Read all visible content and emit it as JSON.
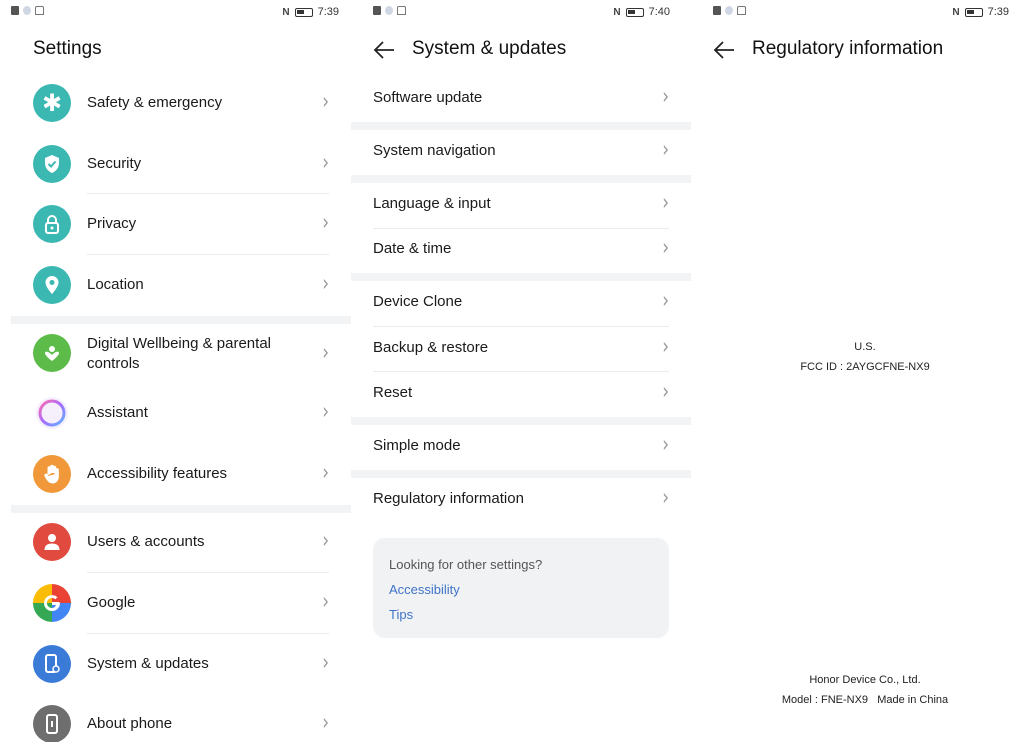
{
  "panel1": {
    "status_time": "7:39",
    "title": "Settings",
    "items": [
      {
        "label": "Safety & emergency",
        "icon": "asterisk-icon",
        "color": "#3cb8b2"
      },
      {
        "label": "Security",
        "icon": "shield-check-icon",
        "color": "#3cb8b2"
      },
      {
        "label": "Privacy",
        "icon": "lock-icon",
        "color": "#3cb8b2"
      },
      {
        "label": "Location",
        "icon": "location-pin-icon",
        "color": "#3cb8b2"
      },
      {
        "label": "Digital Wellbeing & parental controls",
        "icon": "heart-icon",
        "color": "#5dbb4a"
      },
      {
        "label": "Assistant",
        "icon": "assistant-ring-icon",
        "color": "#b56ae8"
      },
      {
        "label": "Accessibility features",
        "icon": "hand-icon",
        "color": "#f0983a"
      },
      {
        "label": "Users & accounts",
        "icon": "person-icon",
        "color": "#e14a3f"
      },
      {
        "label": "Google",
        "icon": "google-icon",
        "color": "#4285f4"
      },
      {
        "label": "System & updates",
        "icon": "phone-settings-icon",
        "color": "#3a7bd8"
      },
      {
        "label": "About phone",
        "icon": "phone-info-icon",
        "color": "#6e6e6e"
      }
    ]
  },
  "panel2": {
    "status_time": "7:40",
    "title": "System & updates",
    "items": [
      {
        "label": "Software update"
      },
      {
        "label": "System navigation"
      },
      {
        "label": "Language & input"
      },
      {
        "label": "Date & time"
      },
      {
        "label": "Device Clone"
      },
      {
        "label": "Backup & restore"
      },
      {
        "label": "Reset"
      },
      {
        "label": "Simple mode"
      },
      {
        "label": "Regulatory information"
      }
    ],
    "card": {
      "question": "Looking for other settings?",
      "link1": "Accessibility",
      "link2": "Tips"
    }
  },
  "panel3": {
    "status_time": "7:39",
    "title": "Regulatory information",
    "region": "U.S.",
    "fcc_id": "FCC ID : 2AYGCFNE-NX9",
    "manufacturer": "Honor Device Co., Ltd.",
    "model": "Model : FNE-NX9   Made in China"
  },
  "chevron": "›"
}
